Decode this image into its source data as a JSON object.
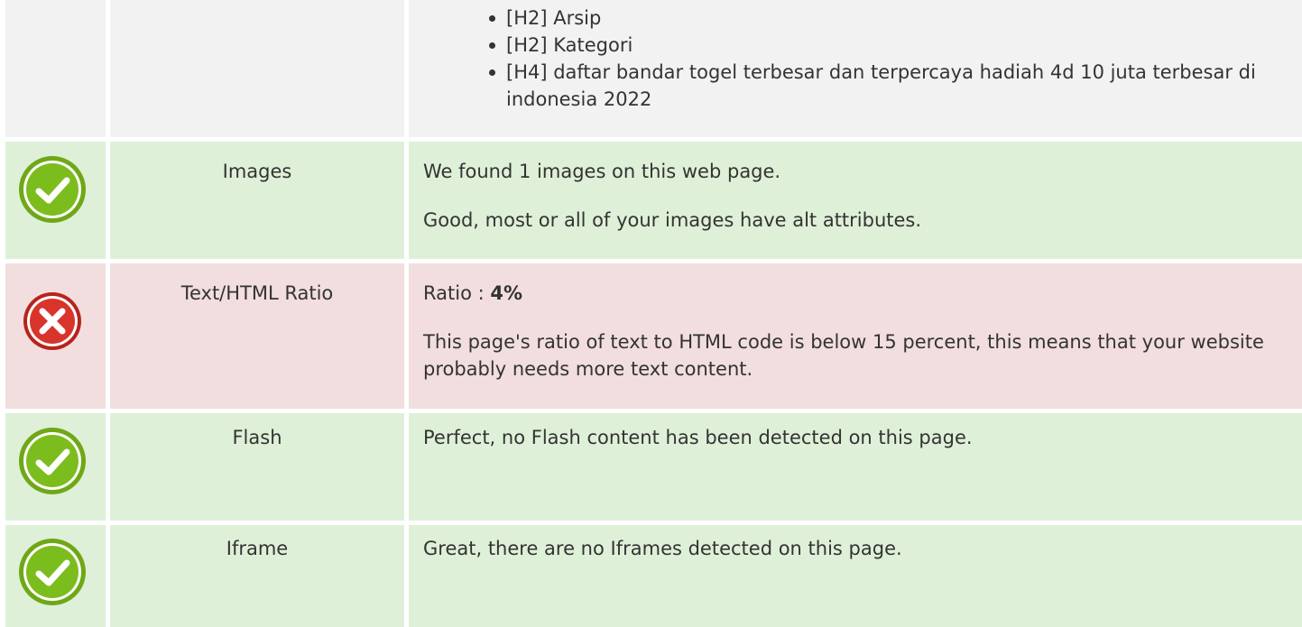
{
  "headings_row": {
    "items": [
      "[H2] Arsip",
      "[H2] Kategori",
      "[H4] daftar bandar togel terbesar dan terpercaya hadiah 4d 10 juta terbesar di indonesia 2022"
    ]
  },
  "images_row": {
    "status": "pass",
    "status_icon": "check-circle-icon",
    "label": "Images",
    "line1": "We found 1 images on this web page.",
    "line2": "Good, most or all of your images have alt attributes."
  },
  "ratio_row": {
    "status": "fail",
    "status_icon": "x-circle-icon",
    "label": "Text/HTML Ratio",
    "ratio_prefix": "Ratio : ",
    "ratio_value": "4%",
    "line2": "This page's ratio of text to HTML code is below 15 percent, this means that your website probably needs more text content."
  },
  "flash_row": {
    "status": "pass",
    "status_icon": "check-circle-icon",
    "label": "Flash",
    "line1": "Perfect, no Flash content has been detected on this page."
  },
  "iframe_row": {
    "status": "pass",
    "status_icon": "check-circle-icon",
    "label": "Iframe",
    "line1": "Great, there are no Iframes detected on this page."
  },
  "colors": {
    "pass_bg": "#dff0d8",
    "fail_bg": "#f2dede",
    "neutral_bg": "#f2f2f2",
    "check_green": "#7cbd1e",
    "error_red": "#d9342b"
  }
}
